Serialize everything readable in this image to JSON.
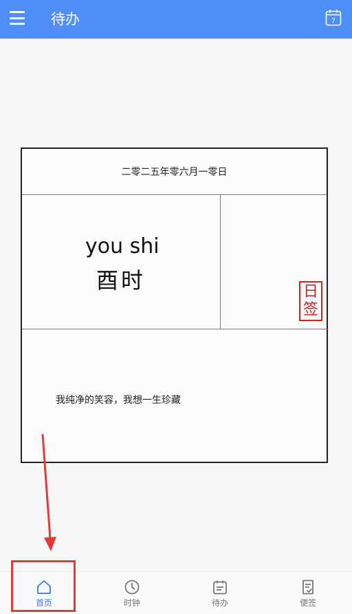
{
  "header": {
    "title": "待办",
    "calendar_day": "7"
  },
  "card": {
    "date": "二零二五年零六月一零日",
    "pinyin": "you shi",
    "hour_name": "酉时",
    "stamp_line1": "日",
    "stamp_line2": "签",
    "quote": "我纯净的笑容，我想一生珍藏"
  },
  "nav": {
    "items": [
      {
        "label": "首页",
        "icon": "home-icon",
        "active": true
      },
      {
        "label": "时钟",
        "icon": "clock-icon",
        "active": false
      },
      {
        "label": "待办",
        "icon": "calendar-icon",
        "active": false
      },
      {
        "label": "便签",
        "icon": "note-icon",
        "active": false
      }
    ]
  },
  "colors": {
    "topbar": "#4f8ef7",
    "active": "#3a7bf0",
    "stamp": "#d62020",
    "annotation": "#e53935"
  }
}
